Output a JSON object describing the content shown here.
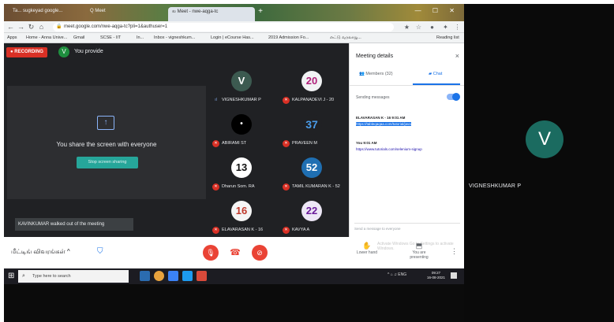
{
  "browser": {
    "tabs": [
      {
        "label": "Ta... sugkeyad google...",
        "active": false
      },
      {
        "label": "Q Meet",
        "active": false
      },
      {
        "label": "ல Meet - nwe-aqga-tc",
        "active": true
      }
    ],
    "new_tab": "+",
    "url": "meet.google.com/nwe-aqga-tc?pli=1&authuser=1",
    "bookmarks": [
      "Apps",
      "Home - Anna Unive...",
      "Gmail",
      "SCSE - IIT",
      "In...",
      "Inbox - vigneshkum...",
      "Login | eCourse Has...",
      "2019 Admission Fo...",
      "எட்டு வரலாறு...",
      "Reading list"
    ]
  },
  "meet": {
    "recording_label": "RECORDING",
    "presenter_initial": "V",
    "presenter_label": "You provide",
    "share_message": "You share the screen with everyone",
    "stop_sharing": "Stop screen sharing",
    "toast": "KAVINKUMAR walked out of the meeting",
    "participants": [
      {
        "name": "VIGNESHKUMAR P",
        "avatar": "V",
        "muted": false,
        "bg": "#3c5a50",
        "fg": "#ffffff"
      },
      {
        "name": "KALPANADEVI J - 20",
        "avatar": "20",
        "muted": true,
        "bg": "#f1f3f4",
        "fg": "#b0207a"
      },
      {
        "name": "ABIRAMI ST",
        "avatar": "•",
        "muted": true,
        "bg": "#000000",
        "fg": "#ffffff"
      },
      {
        "name": "PRAVEEN M",
        "avatar": "37",
        "muted": true,
        "bg": "#202124",
        "fg": "#4a9be8"
      },
      {
        "name": "Dharun Som. RA",
        "avatar": "13",
        "muted": true,
        "bg": "#ffffff",
        "fg": "#111111"
      },
      {
        "name": "TAMIL KUMARAN K - 52",
        "avatar": "52",
        "muted": true,
        "bg": "#1f6fb2",
        "fg": "#ffffff"
      },
      {
        "name": "ELAVARASAN K - 16",
        "avatar": "16",
        "muted": true,
        "bg": "#f5f5f5",
        "fg": "#c0392b"
      },
      {
        "name": "KAVYA A",
        "avatar": "22",
        "muted": true,
        "bg": "#ede7f6",
        "fg": "#6a1b9a"
      }
    ],
    "details": {
      "title": "Meeting details",
      "close": "×",
      "tab_members": "Members (32)",
      "tab_chat": "Chat",
      "toggle_label": "Sending messages",
      "messages": [
        {
          "sender": "ELAVARASAN K - 16   9:01 AM",
          "text": "https://tableqaqaa.com/tutorial/java"
        },
        {
          "sender": "You   9:01 AM",
          "text": "https://www.tutorials.com/selenium-signup"
        }
      ],
      "input_placeholder": "Send a message to everyone"
    },
    "bottom": {
      "meeting_title": "மீட்டிங் விவரங்கள்  ^",
      "raise_hand": "Lower hand",
      "present": "You are presenting",
      "watermark": "Activate Windows\nGo to Settings to activate Windows.",
      "more": "⋮"
    }
  },
  "taskbar": {
    "search_placeholder": "Type here to search",
    "tray": "^  ⌂ ♫  ENG",
    "time": "09:27",
    "date": "16-08-2021"
  },
  "right_panel": {
    "avatar": "V",
    "name": "VIGNESHKUMAR P"
  }
}
